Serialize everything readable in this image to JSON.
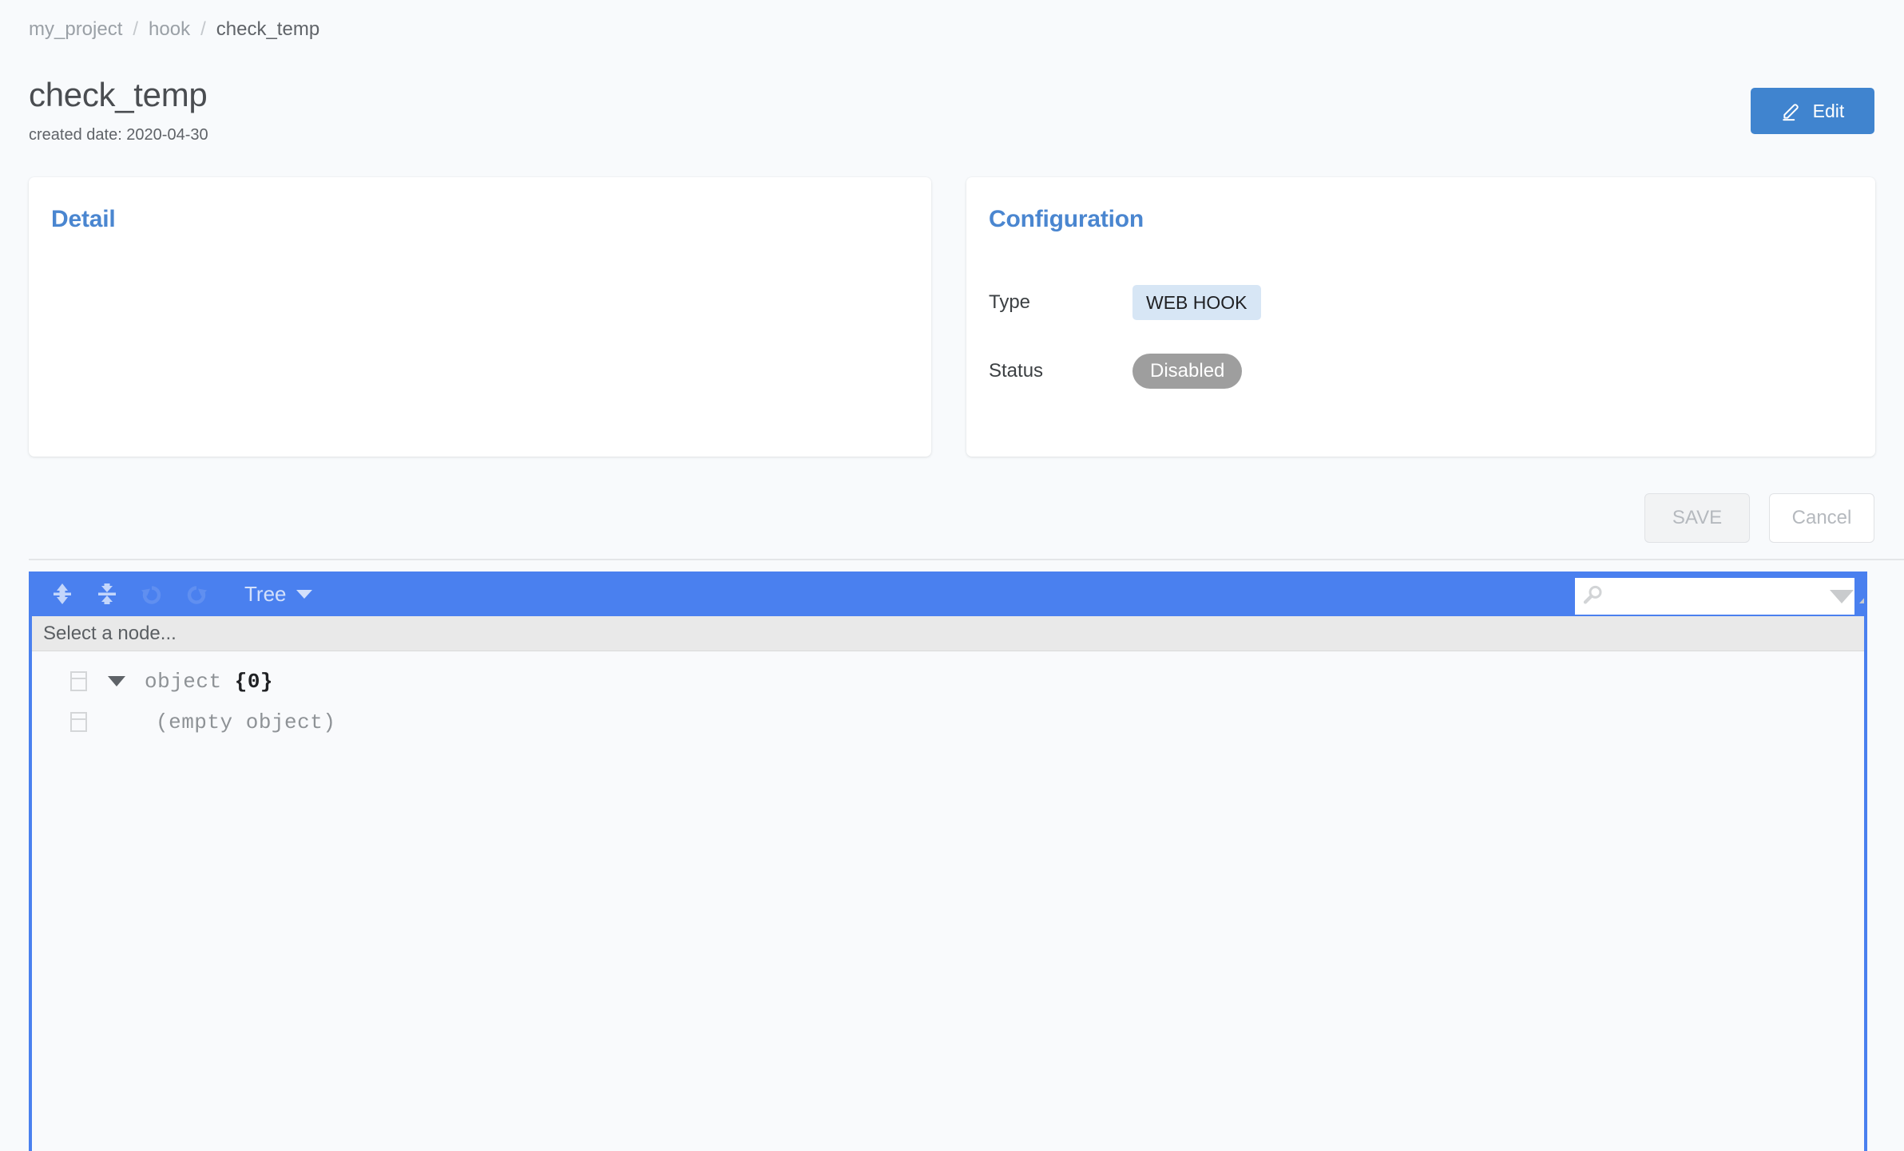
{
  "breadcrumb": {
    "items": [
      {
        "label": "my_project",
        "current": false
      },
      {
        "label": "hook",
        "current": false
      },
      {
        "label": "check_temp",
        "current": true
      }
    ],
    "separator": "/"
  },
  "header": {
    "title": "check_temp",
    "subtitle": "created date: 2020-04-30",
    "edit_label": "Edit",
    "edit_icon": "pencil-icon",
    "edit_color": "#4084cf"
  },
  "detail_card": {
    "title": "Detail",
    "body": ""
  },
  "configuration_card": {
    "title": "Configuration",
    "rows": [
      {
        "label": "Type",
        "value": "WEB HOOK",
        "style": "chip",
        "color": "#d7e6f5"
      },
      {
        "label": "Status",
        "value": "Disabled",
        "style": "pill",
        "color": "#9e9e9e"
      }
    ]
  },
  "actions": {
    "save_label": "SAVE",
    "cancel_label": "Cancel"
  },
  "json_editor": {
    "toolbar": {
      "expand_all_icon": "expand-all-icon",
      "collapse_all_icon": "collapse-all-icon",
      "undo_icon": "undo-icon",
      "redo_icon": "redo-icon",
      "mode_label": "Tree",
      "mode_caret_icon": "chevron-down-icon",
      "background": "#4a80ef"
    },
    "search": {
      "icon": "search-icon",
      "value": "",
      "placeholder": "",
      "next_icon": "triangle-down-icon",
      "prev_icon": "triangle-up-icon"
    },
    "status_text": "Select a node...",
    "tree": {
      "root": {
        "handle_icon": "drag-handle-icon",
        "expand_icon": "triangle-down-icon",
        "name": "object ",
        "count": "{0}"
      },
      "child": {
        "handle_icon": "drag-handle-icon",
        "text": "(empty object)"
      }
    }
  }
}
